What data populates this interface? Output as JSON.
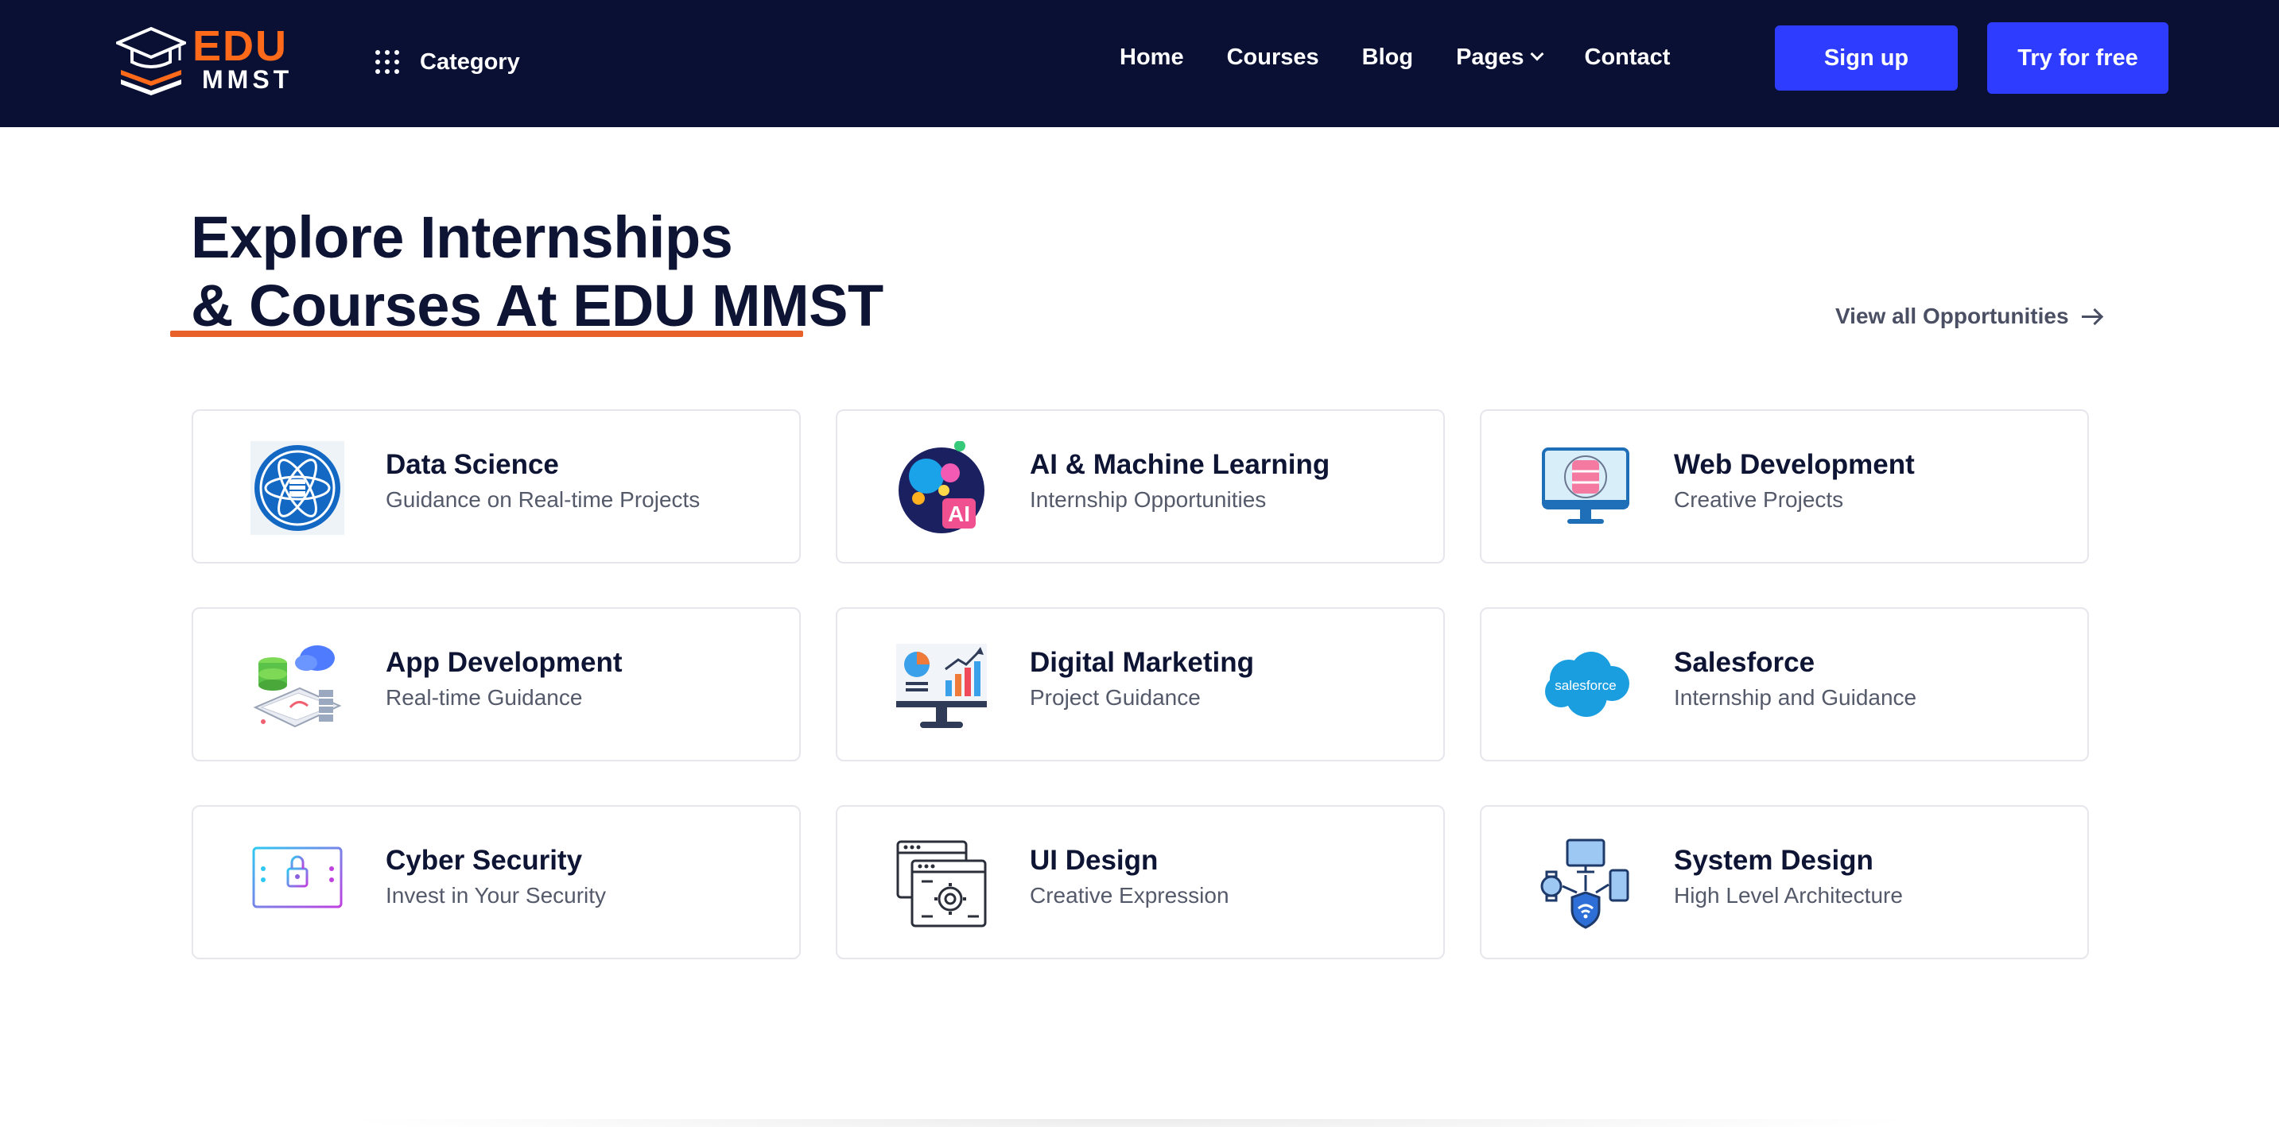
{
  "logo": {
    "edu": "EDU",
    "mmst": "MMST"
  },
  "nav": {
    "category_label": "Category",
    "links": [
      "Home",
      "Courses",
      "Blog",
      "Pages",
      "Contact"
    ],
    "signup_label": "Sign up",
    "try_label": "Try for free"
  },
  "hero": {
    "heading_line1": "Explore Internships",
    "heading_line2": "& Courses At EDU MMST",
    "view_all_label": "View all Opportunities"
  },
  "colors": {
    "navbar_bg": "#0a1033",
    "accent_blue": "#2d3cff",
    "accent_orange": "#ff6a1a",
    "heading_text": "#0e1433"
  },
  "cards": [
    {
      "title": "Data Science",
      "subtitle": "Guidance on Real-time Projects",
      "icon": "data-science-icon"
    },
    {
      "title": "AI & Machine Learning",
      "subtitle": "Internship Opportunities",
      "icon": "ai-icon"
    },
    {
      "title": "Web Development",
      "subtitle": "Creative Projects",
      "icon": "web-development-icon"
    },
    {
      "title": "App Development",
      "subtitle": "Real-time Guidance",
      "icon": "app-development-icon"
    },
    {
      "title": "Digital Marketing",
      "subtitle": "Project Guidance",
      "icon": "digital-marketing-icon"
    },
    {
      "title": "Salesforce",
      "subtitle": "Internship and Guidance",
      "icon": "salesforce-icon",
      "icon_text": "salesforce"
    },
    {
      "title": "Cyber Security",
      "subtitle": "Invest in Your Security",
      "icon": "cyber-security-icon"
    },
    {
      "title": "UI Design",
      "subtitle": "Creative Expression",
      "icon": "ui-design-icon"
    },
    {
      "title": "System Design",
      "subtitle": "High Level Architecture",
      "icon": "system-design-icon"
    }
  ]
}
